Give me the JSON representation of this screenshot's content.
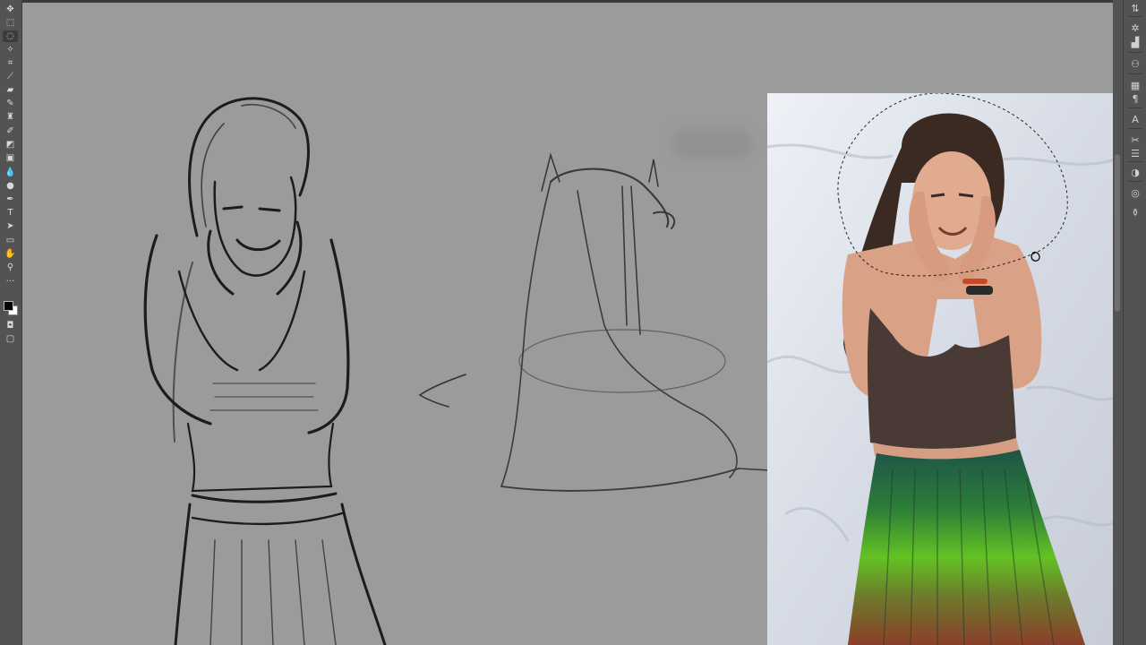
{
  "toolbar": {
    "tools": [
      {
        "name": "move-tool-icon",
        "glyph": "✥"
      },
      {
        "name": "marquee-tool-icon",
        "glyph": "⬚"
      },
      {
        "name": "lasso-tool-icon",
        "glyph": "◌",
        "active": true
      },
      {
        "name": "magic-wand-icon",
        "glyph": "✧"
      },
      {
        "name": "crop-tool-icon",
        "glyph": "⌗"
      },
      {
        "name": "eyedropper-icon",
        "glyph": "⟋"
      },
      {
        "name": "healing-brush-icon",
        "glyph": "▰"
      },
      {
        "name": "brush-tool-icon",
        "glyph": "✎"
      },
      {
        "name": "clone-stamp-icon",
        "glyph": "♜"
      },
      {
        "name": "history-brush-icon",
        "glyph": "✐"
      },
      {
        "name": "eraser-icon",
        "glyph": "◩"
      },
      {
        "name": "gradient-tool-icon",
        "glyph": "▣"
      },
      {
        "name": "blur-tool-icon",
        "glyph": "💧"
      },
      {
        "name": "dodge-tool-icon",
        "glyph": "●"
      },
      {
        "name": "pen-tool-icon",
        "glyph": "✒"
      },
      {
        "name": "type-tool-icon",
        "glyph": "T"
      },
      {
        "name": "path-selection-icon",
        "glyph": "➤"
      },
      {
        "name": "rectangle-tool-icon",
        "glyph": "▭"
      },
      {
        "name": "hand-tool-icon",
        "glyph": "✋"
      },
      {
        "name": "zoom-tool-icon",
        "glyph": "⚲"
      },
      {
        "name": "more-tools-icon",
        "glyph": "···"
      }
    ]
  },
  "rightbar": {
    "icons": [
      {
        "name": "panel-arrange-icon",
        "glyph": "⇅"
      },
      {
        "name": "brush-settings-icon",
        "glyph": "✲"
      },
      {
        "name": "histogram-icon",
        "glyph": "▟"
      },
      {
        "name": "clone-source-icon",
        "glyph": "⚇"
      },
      {
        "name": "adjustments-icon",
        "glyph": "▦"
      },
      {
        "name": "paragraph-icon",
        "glyph": "¶"
      },
      {
        "name": "character-icon",
        "glyph": "A"
      },
      {
        "name": "tools-icon",
        "glyph": "✂"
      },
      {
        "name": "layers-icon",
        "glyph": "☰"
      },
      {
        "name": "channels-icon",
        "glyph": "◑"
      },
      {
        "name": "paths-icon",
        "glyph": "◎"
      },
      {
        "name": "styles-icon",
        "glyph": "⚱"
      }
    ]
  },
  "colors": {
    "ui_bg": "#535353",
    "canvas_bg": "#9b9b9b",
    "foreground": "#000000",
    "background": "#ffffff"
  }
}
